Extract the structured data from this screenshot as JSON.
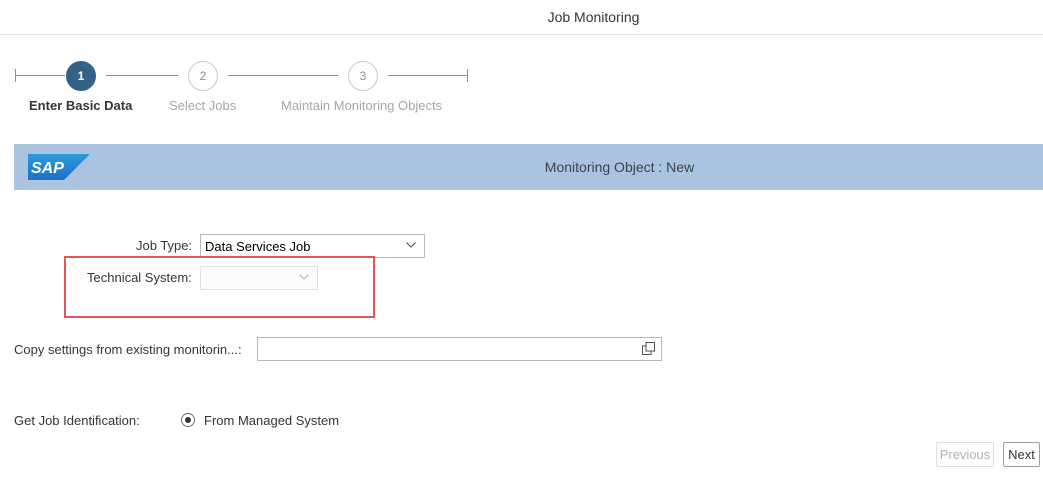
{
  "header": {
    "title": "Job Monitoring"
  },
  "wizard": {
    "steps": [
      {
        "number": "1",
        "label": "Enter Basic Data",
        "state": "active"
      },
      {
        "number": "2",
        "label": "Select Jobs",
        "state": "inactive"
      },
      {
        "number": "3",
        "label": "Maintain Monitoring Objects",
        "state": "inactive"
      }
    ]
  },
  "object_bar": {
    "logo_text": "SAP",
    "title": "Monitoring Object : New",
    "color": "#a9c3e0"
  },
  "form": {
    "job_type": {
      "label": "Job Type:",
      "value": "Data Services Job"
    },
    "technical_system": {
      "label": "Technical System:",
      "value": ""
    },
    "copy_settings": {
      "label": "Copy settings from existing monitorin...:",
      "value": ""
    },
    "job_identification": {
      "label": "Get Job Identification:",
      "option": "From Managed System",
      "selected": true
    }
  },
  "footer": {
    "previous_label": "Previous",
    "next_label": "Next"
  },
  "colors": {
    "accent": "#346187",
    "highlight_box": "#e05555"
  }
}
